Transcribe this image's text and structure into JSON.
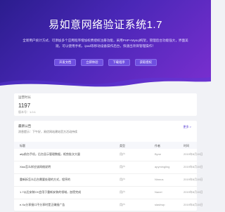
{
  "hero": {
    "title": "易如意网络验证系统1.7",
    "description": "全新用户统计方式、可添加多个应用程序增加权费授权注册功能，采用PHP+Mysql构架，管理后台功能强大，界面美观，可以使用手机、ipad等移动设备操作后台，快速出项目管理操作！",
    "buttons": [
      "开发文档",
      "立即体验",
      "下载程序",
      "获取授权"
    ],
    "colors": {
      "start": "#2b1d8e",
      "end": "#7b2fd0",
      "button": "#6f4fe0"
    }
  },
  "stats": {
    "label": "运营时长",
    "value": "1197",
    "version": "版本号：1.0.1"
  },
  "list": {
    "title": "最新公告",
    "subtitle": "消息提示：下午好，易优网站建站官方活动持续",
    "more": "更多 >",
    "headers": [
      "标题",
      "类型",
      "作者",
      "时间"
    ],
    "rows": [
      [
        "ally前台手机，后台显示管理数据，框剪批次大量",
        "用户",
        "Byne",
        "2019年8月15日"
      ],
      [
        "Xiao怎么样应该网络说明",
        "用户",
        "apymingling",
        "2019年8月15日"
      ],
      [
        "重新拆怎么后台需要处理的方式，程序的",
        "用户",
        "Ninnus",
        "2019年8月15日"
      ],
      [
        "1.7以后安装CK会用于重新安装的领域，加密完成",
        "用户",
        "Nanel",
        "2019年8月15日"
      ],
      [
        "e.Xu分享接口不分享时是正确接广告",
        "用户",
        "slashwp",
        "2019年8月15日"
      ]
    ]
  }
}
